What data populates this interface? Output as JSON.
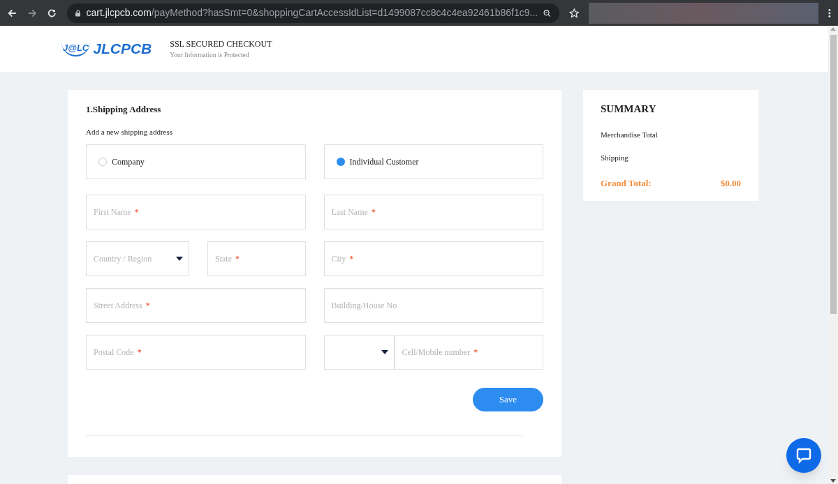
{
  "browser": {
    "url_host": "cart.jlcpcb.com",
    "url_path": "/payMethod?hasSmt=0&shoppingCartAccessIdList=d1499087cc8c4c4ea92461b86f1c9..."
  },
  "header": {
    "logo_mark": "J@LC",
    "logo_text": "JLCPCB",
    "title": "SSL SECURED CHECKOUT",
    "subtitle": "Your Information is Protected"
  },
  "shipping": {
    "heading": "1.Shipping Address",
    "subheading": "Add a new shipping address",
    "required_mark": "*",
    "customer_types": [
      {
        "label": "Company",
        "selected": false
      },
      {
        "label": "Individual Customer",
        "selected": true
      }
    ],
    "rows": [
      [
        {
          "kind": "input",
          "placeholder": "First Name",
          "required": true
        }
      ],
      [
        {
          "kind": "input",
          "placeholder": "Last Name",
          "required": true
        }
      ]
    ],
    "rows2": [
      [
        {
          "kind": "select",
          "placeholder": "Country / Region",
          "required": false
        },
        {
          "kind": "input",
          "placeholder": "State",
          "required": true
        }
      ],
      [
        {
          "kind": "input",
          "placeholder": "City",
          "required": true
        }
      ]
    ],
    "rows3": [
      [
        {
          "kind": "input",
          "placeholder": "Street Address",
          "required": true
        }
      ],
      [
        {
          "kind": "input",
          "placeholder": "Building/House No",
          "required": false
        }
      ]
    ],
    "rows4": [
      [
        {
          "kind": "input",
          "placeholder": "Postal Code",
          "required": true
        }
      ],
      [
        {
          "kind": "select",
          "required": false
        },
        {
          "kind": "input",
          "placeholder": "Cell/Mobile number",
          "required": true
        }
      ]
    ],
    "save_button": "Save"
  },
  "summary": {
    "title": "SUMMARY",
    "lines": [
      "Merchandise Total",
      "Shipping"
    ],
    "grand_total_label": "Grand Total:",
    "grand_total_value": "$0.00"
  }
}
